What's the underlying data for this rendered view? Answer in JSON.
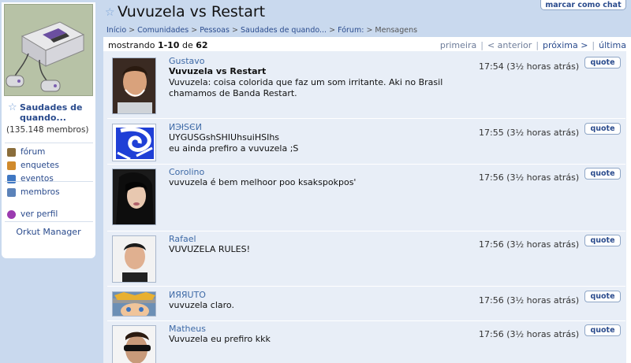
{
  "community": {
    "name": "Saudades de quando...",
    "members": "(135.148 membros)",
    "manager": "Orkut Manager"
  },
  "sidebar": {
    "links": [
      {
        "label": "fórum",
        "icon": "forum-icon",
        "color": "#8a6d3b"
      },
      {
        "label": "enquetes",
        "icon": "poll-icon",
        "color": "#d08a2c"
      },
      {
        "label": "eventos",
        "icon": "calendar-icon",
        "color": "#3f77c2"
      },
      {
        "label": "membros",
        "icon": "members-icon",
        "color": "#5b82b9"
      },
      {
        "label": "ver perfil",
        "icon": "profile-icon",
        "color": "#9b3bb0"
      }
    ]
  },
  "header": {
    "title": "Vuvuzela vs Restart",
    "chat_button": "marcar como chat",
    "breadcrumb": [
      "Início",
      "Comunidades",
      "Pessoas",
      "Saudades de quando...",
      "Fórum:",
      "Mensagens"
    ]
  },
  "paging": {
    "prefix": "mostrando ",
    "range": "1-10",
    "of": " de ",
    "total": "62",
    "first": "primeira",
    "prev": "< anterior",
    "next": "próxima >",
    "last": "última"
  },
  "messages": [
    {
      "author": "Gustavo",
      "subject": "Vuvuzela vs Restart",
      "text": "Vuvuzela: coisa colorida que faz um som irritante. Aki no Brasil chamamos de Banda Restart.",
      "time": "17:54 (3½ horas atrás)",
      "quote": "quote"
    },
    {
      "author": "ИЭłЅЄИ",
      "subject": "",
      "text": "UYGUSGshSHIUhsuiHSIhs\neu ainda prefiro a vuvuzela ;S",
      "time": "17:55 (3½ horas atrás)",
      "quote": "quote"
    },
    {
      "author": "Corolino",
      "subject": "",
      "text": "vuvuzela é bem melhoor poo ksakspokpos'",
      "time": "17:56 (3½ horas atrás)",
      "quote": "quote"
    },
    {
      "author": "Rafael",
      "subject": "",
      "text": "VUVUZELA RULES!",
      "time": "17:56 (3½ horas atrás)",
      "quote": "quote"
    },
    {
      "author": "ИЯЯUTO",
      "subject": "",
      "text": "vuvuzela claro.",
      "time": "17:56 (3½ horas atrás)",
      "quote": "quote"
    },
    {
      "author": "Matheus",
      "subject": "",
      "text": "Vuvuzela eu prefiro kkk",
      "time": "17:56 (3½ horas atrás)",
      "quote": "quote"
    }
  ]
}
